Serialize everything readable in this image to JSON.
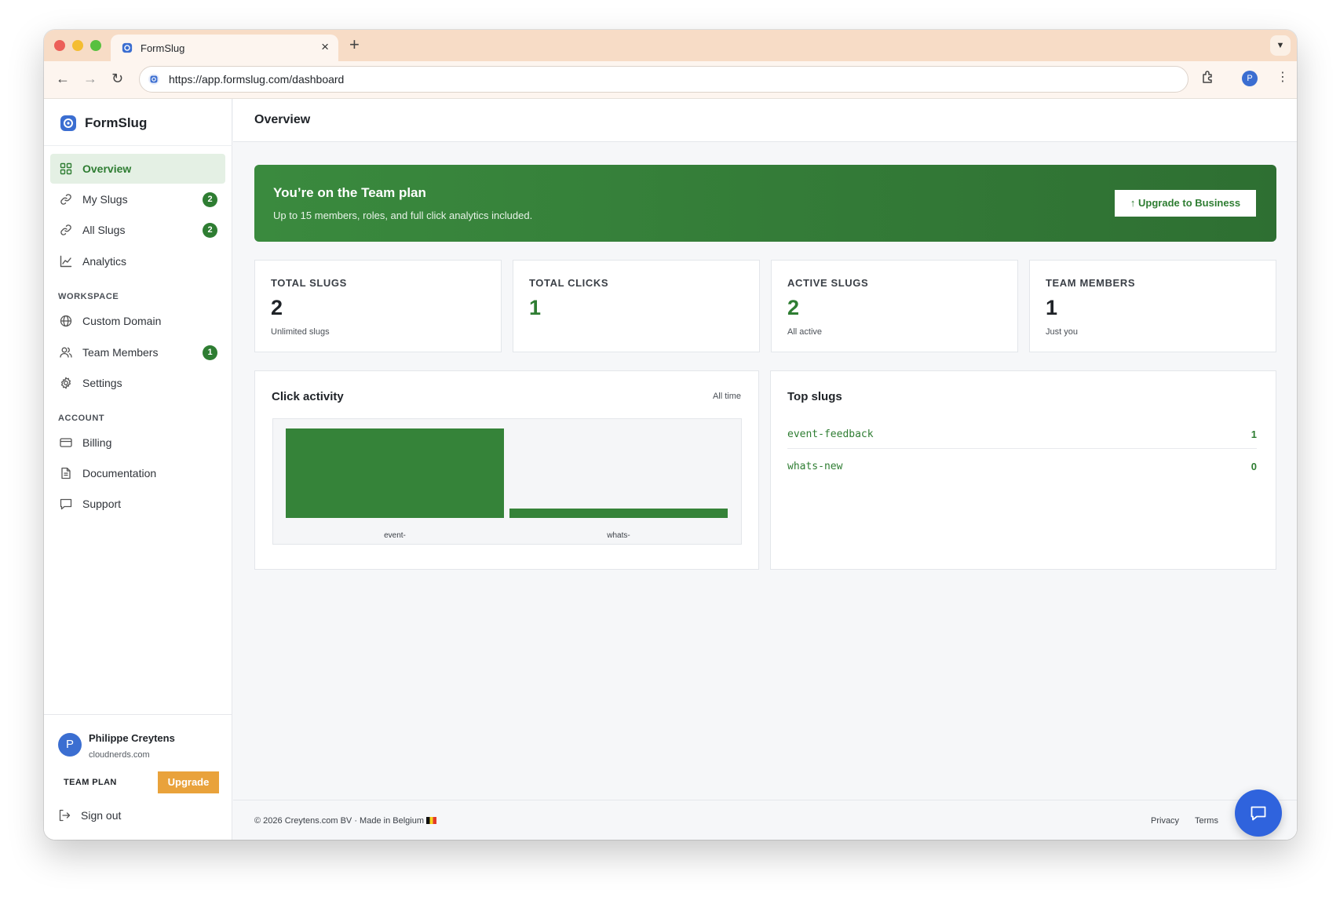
{
  "browser": {
    "tab_title": "FormSlug",
    "url": "https://app.formslug.com/dashboard",
    "profile_initial": "P"
  },
  "brand": {
    "name": "FormSlug",
    "accent": "#2e7d32",
    "logo_color": "#3b6ed1"
  },
  "sidebar": {
    "main_items": [
      {
        "label": "Overview",
        "icon": "grid-icon",
        "active": true
      },
      {
        "label": "My Slugs",
        "icon": "link-icon",
        "badge": "2"
      },
      {
        "label": "All Slugs",
        "icon": "link-icon",
        "badge": "2"
      },
      {
        "label": "Analytics",
        "icon": "chart-line-icon"
      }
    ],
    "workspace_heading": "WORKSPACE",
    "workspace_items": [
      {
        "label": "Custom Domain",
        "icon": "globe-icon"
      },
      {
        "label": "Team Members",
        "icon": "users-icon",
        "badge": "1"
      },
      {
        "label": "Settings",
        "icon": "gear-icon"
      }
    ],
    "account_heading": "ACCOUNT",
    "account_items": [
      {
        "label": "Billing",
        "icon": "credit-card-icon"
      },
      {
        "label": "Documentation",
        "icon": "document-icon"
      },
      {
        "label": "Support",
        "icon": "chat-icon"
      }
    ],
    "user": {
      "initial": "P",
      "name": "Philippe Creytens",
      "org": "cloudnerds.com",
      "plan": "TEAM PLAN",
      "upgrade_label": "Upgrade"
    },
    "sign_out": "Sign out"
  },
  "header": {
    "title": "Overview"
  },
  "banner": {
    "title": "You’re on the Team plan",
    "subtitle": "Up to 15 members, roles, and full click analytics included.",
    "button": "↑ Upgrade to Business"
  },
  "stats": [
    {
      "label": "TOTAL SLUGS",
      "value": "2",
      "sub": "Unlimited slugs",
      "color": "#1f2328"
    },
    {
      "label": "TOTAL CLICKS",
      "value": "1",
      "sub": "",
      "color": "#2e7d32"
    },
    {
      "label": "ACTIVE SLUGS",
      "value": "2",
      "sub": "All active",
      "color": "#2e7d32"
    },
    {
      "label": "TEAM MEMBERS",
      "value": "1",
      "sub": "Just you",
      "color": "#1f2328"
    }
  ],
  "click_activity": {
    "title": "Click activity",
    "range": "All time"
  },
  "chart_data": {
    "type": "bar",
    "categories": [
      "event-",
      "whats-"
    ],
    "values": [
      1,
      0
    ],
    "title": "Click activity",
    "xlabel": "",
    "ylabel": "",
    "ylim": [
      0,
      1
    ],
    "grid": false,
    "bar_color": "#358339"
  },
  "top_slugs": {
    "title": "Top slugs",
    "rows": [
      {
        "slug": "event-feedback",
        "count": "1"
      },
      {
        "slug": "whats-new",
        "count": "0"
      }
    ]
  },
  "footer": {
    "copyright": "© 2026 Creytens.com BV · Made in Belgium",
    "privacy": "Privacy",
    "terms": "Terms"
  }
}
